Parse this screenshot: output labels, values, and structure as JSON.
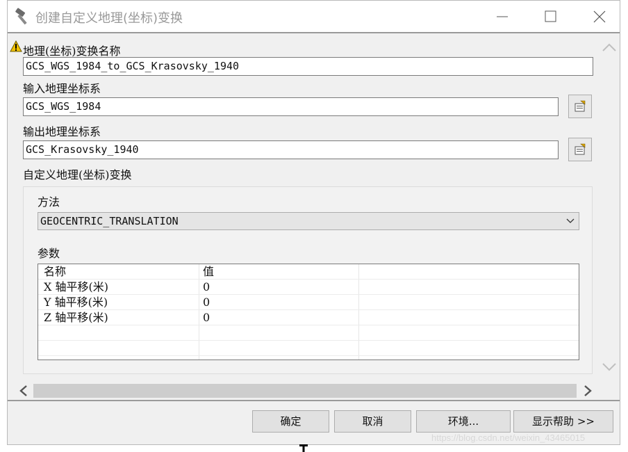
{
  "window": {
    "title": "创建自定义地理(坐标)变换",
    "icon": "hammer-icon",
    "controls": [
      "minimize-icon",
      "maximize-icon",
      "close-icon"
    ]
  },
  "form": {
    "name_label": "地理(坐标)变换名称",
    "name_value": "GCS_WGS_1984_to_GCS_Krasovsky_1940",
    "input_label": "输入地理坐标系",
    "input_value": "GCS_WGS_1984",
    "output_label": "输出地理坐标系",
    "output_value": "GCS_Krasovsky_1940",
    "custom_label": "自定义地理(坐标)变换",
    "method_label": "方法",
    "method_value": "GEOCENTRIC_TRANSLATION",
    "params_label": "参数"
  },
  "params_table": {
    "headers": [
      "名称",
      "值"
    ],
    "rows": [
      [
        "X 轴平移(米)",
        "0"
      ],
      [
        "Y 轴平移(米)",
        "0"
      ],
      [
        "Z 轴平移(米)",
        "0"
      ]
    ]
  },
  "buttons": {
    "ok": "确定",
    "cancel": "取消",
    "env": "环境...",
    "help": "显示帮助 >>"
  },
  "watermark": "https://blog.csdn.net/weixin_43465015",
  "colors": {
    "warning": "#f2c200",
    "field_border": "#7a7a7a",
    "button_bg": "#e1e1e1"
  }
}
